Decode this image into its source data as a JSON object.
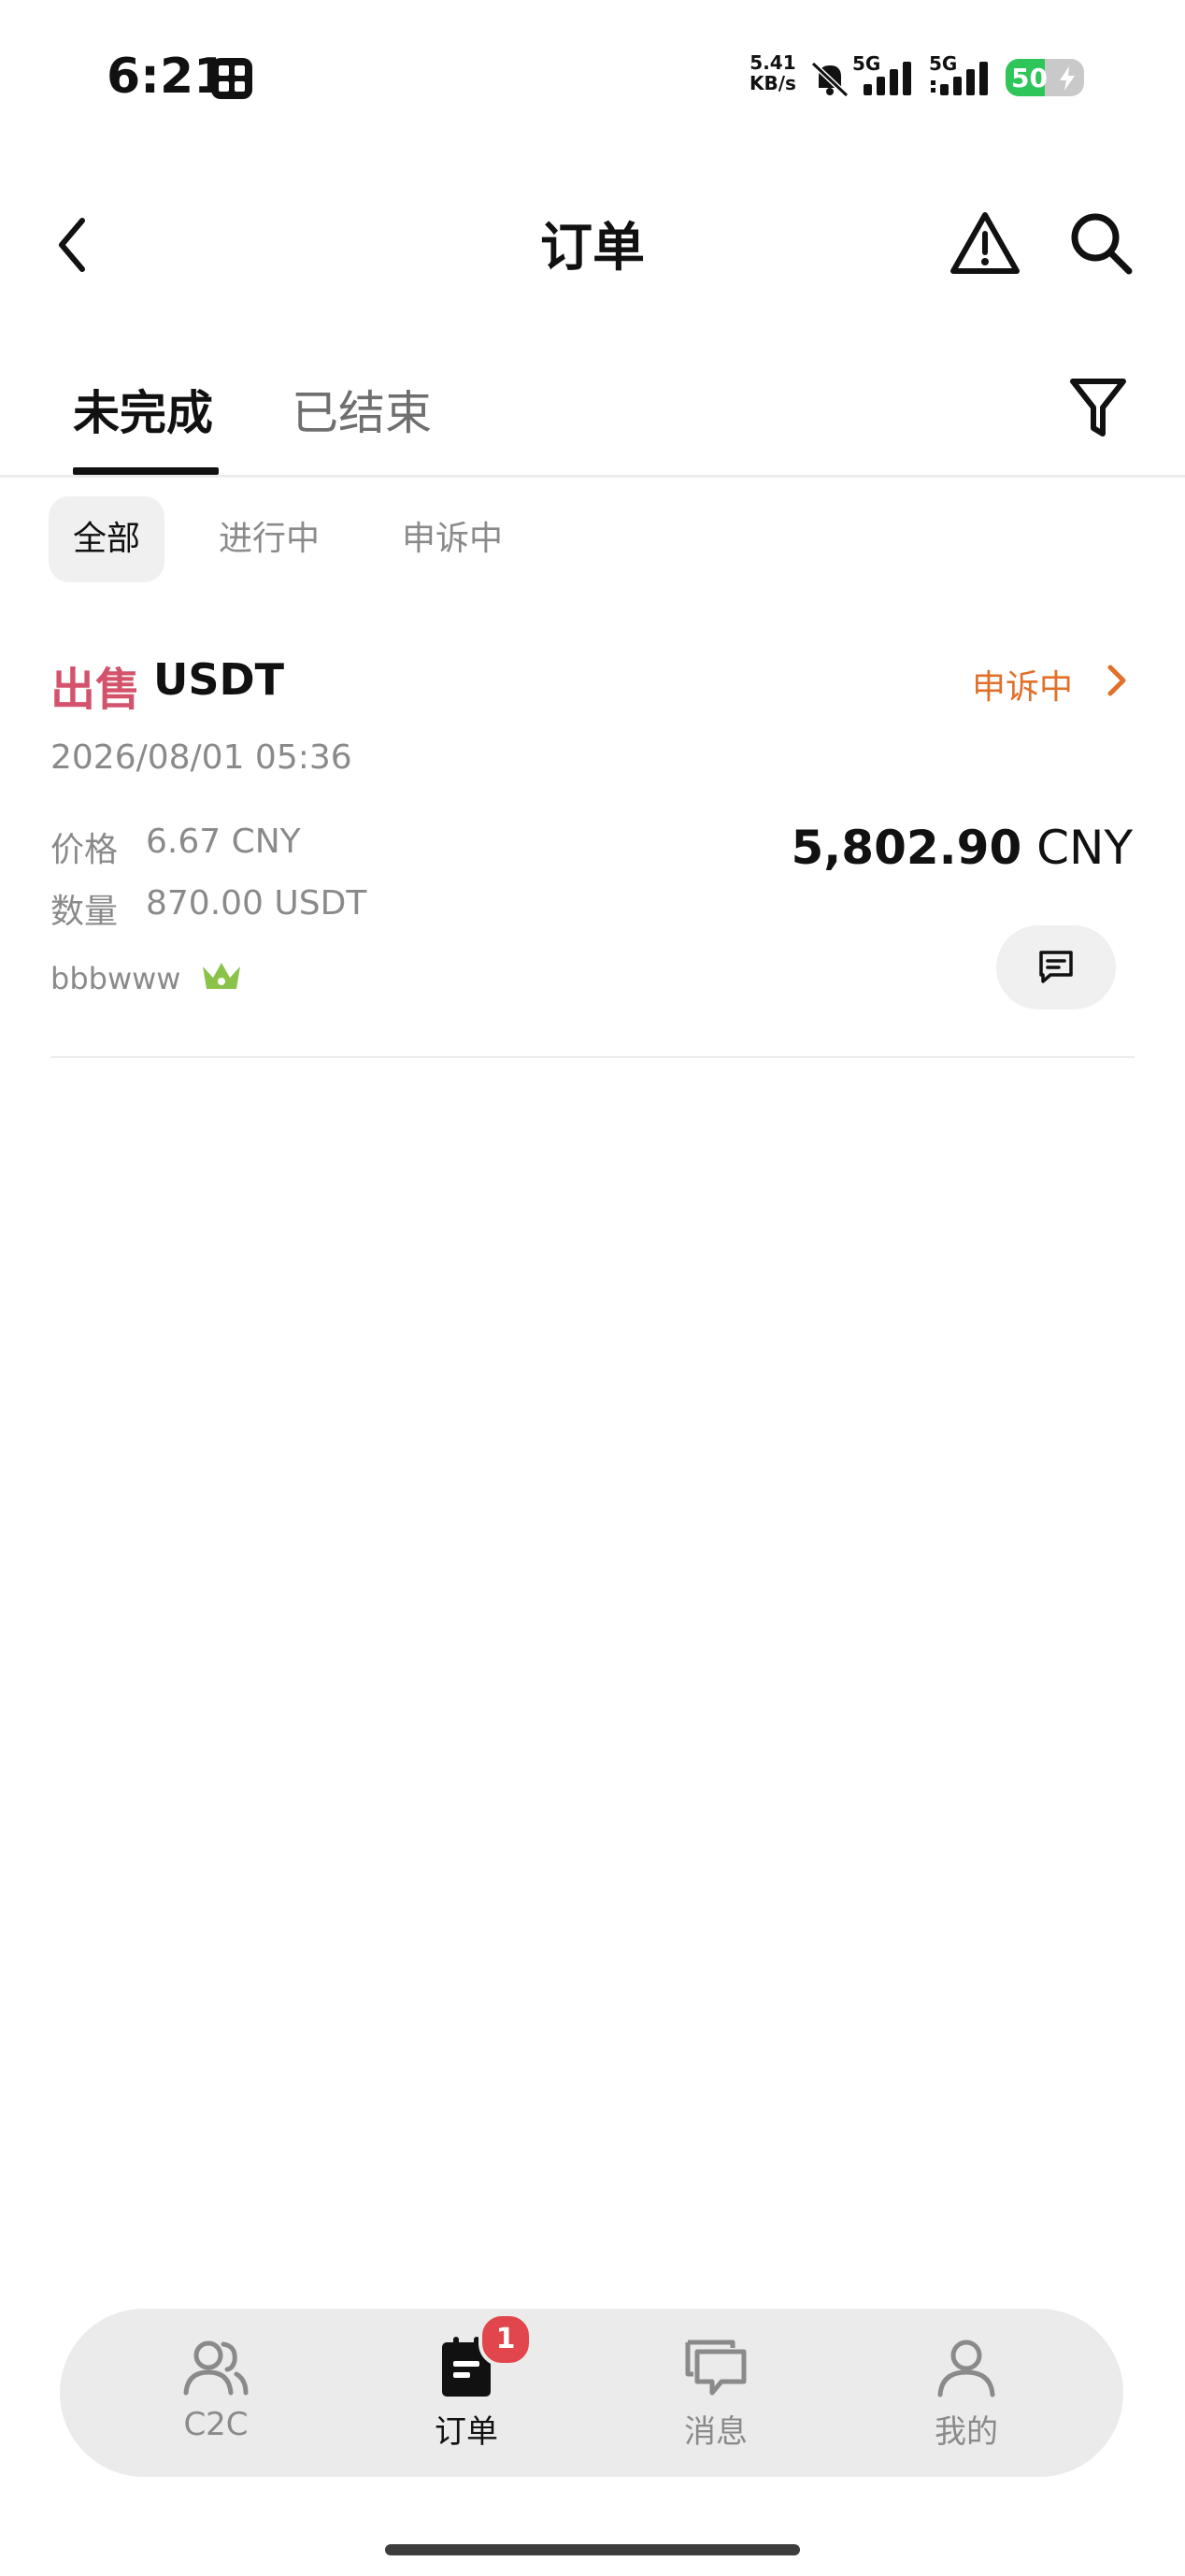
{
  "status_bar": {
    "time": "6:21",
    "net_speed_value": "5.41",
    "net_speed_unit": "KB/s",
    "signal_1": "5G",
    "signal_2": "5G",
    "battery": "50",
    "battery_level": 0.5
  },
  "header": {
    "title": "订单"
  },
  "tabs": [
    {
      "label": "未完成",
      "active": true
    },
    {
      "label": "已结束",
      "active": false
    }
  ],
  "sub_filters": [
    {
      "label": "全部",
      "active": true
    },
    {
      "label": "进行中",
      "active": false
    },
    {
      "label": "申诉中",
      "active": false
    }
  ],
  "order": {
    "side": "出售",
    "asset": "USDT",
    "status": "申诉中",
    "time": "2026/08/01 05:36",
    "price_label": "价格",
    "price_value": "6.67 CNY",
    "qty_label": "数量",
    "qty_value": "870.00 USDT",
    "total_amount": "5,802.90",
    "total_currency": "CNY",
    "merchant": "bbbwww"
  },
  "bottom_nav": {
    "items": [
      {
        "label": "C2C",
        "icon": "users-icon",
        "active": false
      },
      {
        "label": "订单",
        "icon": "order-icon",
        "active": true
      },
      {
        "label": "消息",
        "icon": "messages-icon",
        "active": false
      },
      {
        "label": "我的",
        "icon": "profile-icon",
        "active": false
      }
    ],
    "order_badge": "1"
  },
  "colors": {
    "sell": "#d4536c",
    "status": "#e0702a",
    "badge": "#e0464b",
    "crown": "#8bc34a",
    "battery": "#2ec65a"
  }
}
